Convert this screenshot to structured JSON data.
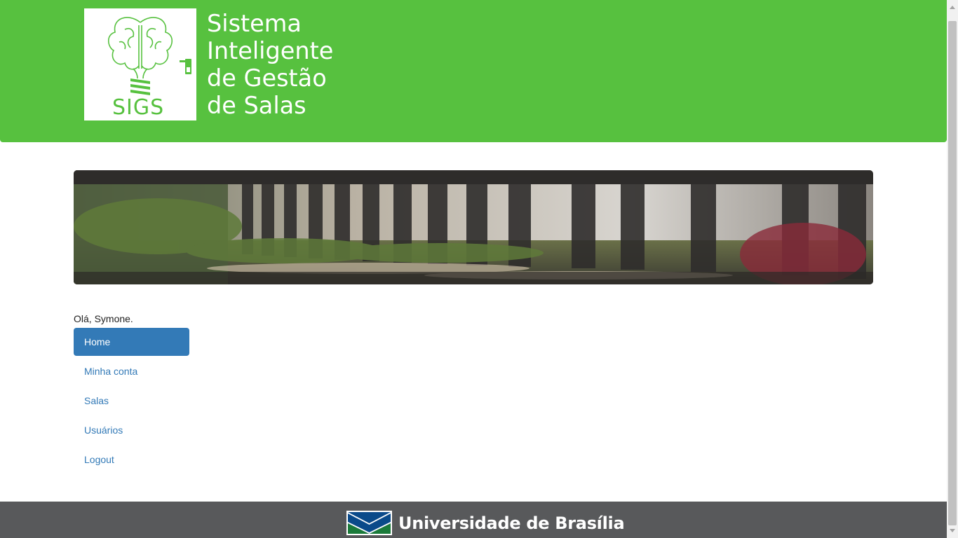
{
  "header": {
    "logo_text": "SIGS",
    "title_lines": [
      "Sistema",
      "Inteligente",
      "de Gestão",
      "de Salas"
    ],
    "color": "#57c13f"
  },
  "banner": {
    "icon": "colonnade-photo"
  },
  "greeting": "Olá, Symone.",
  "nav": {
    "items": [
      {
        "label": "Home",
        "active": true
      },
      {
        "label": "Minha conta"
      },
      {
        "label": "Salas"
      },
      {
        "label": "Usuários"
      },
      {
        "label": "Logout"
      }
    ],
    "active_color": "#337ab7"
  },
  "footer": {
    "org_name": "Universidade de Brasília",
    "color": "#58595b"
  }
}
